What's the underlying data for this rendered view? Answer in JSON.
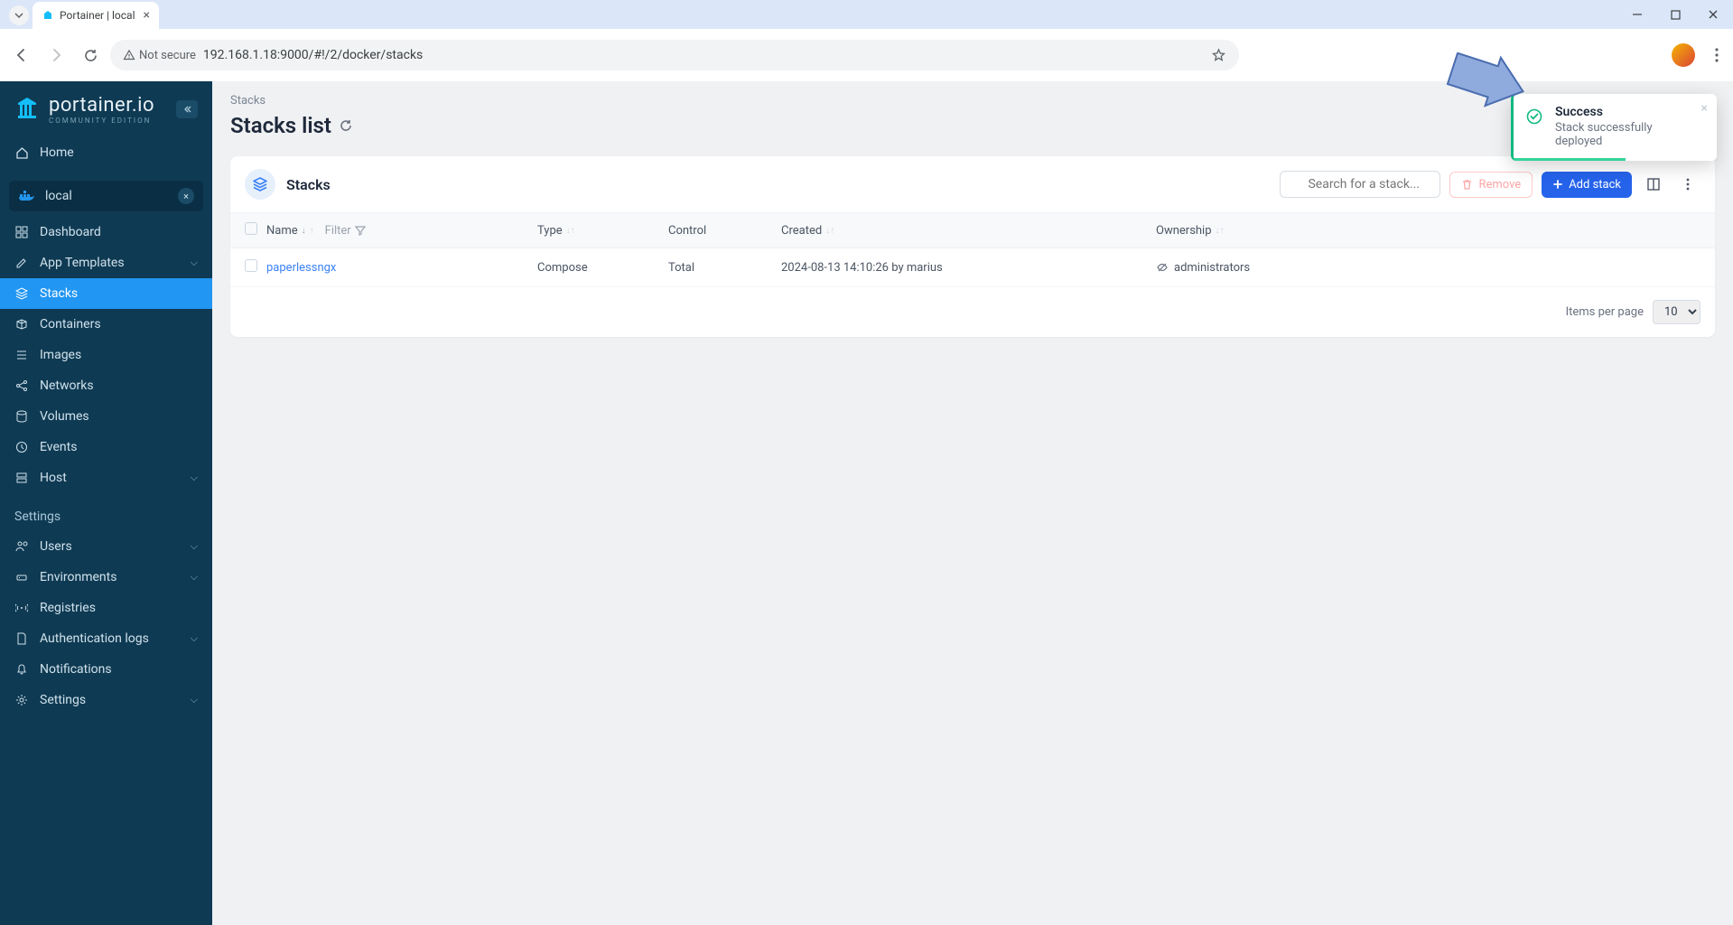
{
  "browser": {
    "tab_title": "Portainer | local",
    "not_secure_label": "Not secure",
    "url": "192.168.1.18:9000/#!/2/docker/stacks"
  },
  "sidebar": {
    "brand": "portainer.io",
    "brand_sub": "COMMUNITY EDITION",
    "home": "Home",
    "env_name": "local",
    "items": {
      "dashboard": "Dashboard",
      "app_templates": "App Templates",
      "stacks": "Stacks",
      "containers": "Containers",
      "images": "Images",
      "networks": "Networks",
      "volumes": "Volumes",
      "events": "Events",
      "host": "Host"
    },
    "settings_label": "Settings",
    "settings": {
      "users": "Users",
      "environments": "Environments",
      "registries": "Registries",
      "auth_logs": "Authentication logs",
      "notifications": "Notifications",
      "settings": "Settings"
    }
  },
  "main": {
    "breadcrumb": "Stacks",
    "title": "Stacks list",
    "card_title": "Stacks",
    "search_placeholder": "Search for a stack...",
    "remove_label": "Remove",
    "add_label": "Add stack",
    "columns": {
      "name": "Name",
      "filter": "Filter",
      "type": "Type",
      "control": "Control",
      "created": "Created",
      "ownership": "Ownership"
    },
    "row": {
      "name": "paperlessngx",
      "type": "Compose",
      "control": "Total",
      "created": "2024-08-13 14:10:26 by marius",
      "ownership": "administrators"
    },
    "items_per_page_label": "Items per page",
    "items_per_page_value": "10"
  },
  "toast": {
    "title": "Success",
    "message": "Stack successfully deployed"
  }
}
